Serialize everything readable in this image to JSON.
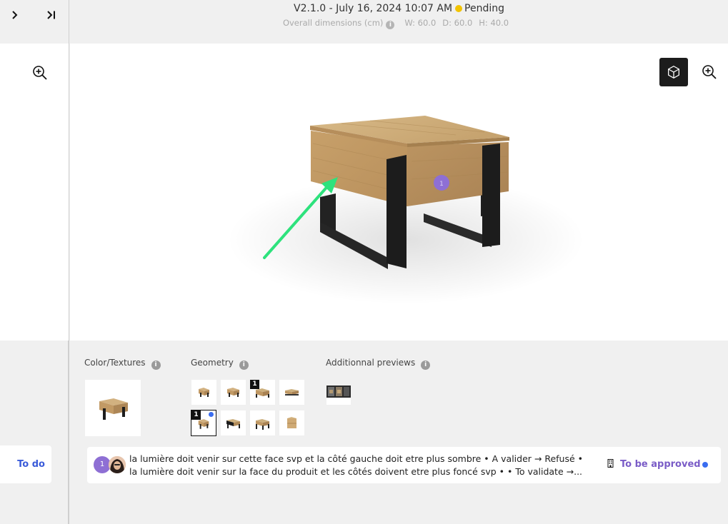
{
  "header": {
    "version": "V2.1.0 - July 16, 2024 10:07 AM",
    "status": "Pending",
    "status_color": "#f2c300",
    "dims_label": "Overall dimensions (cm)",
    "width": "W: 60.0",
    "depth": "D: 60.0",
    "height": "H: 40.0"
  },
  "sidebar": {
    "expand_icon": "chevron-right-icon",
    "collapse_icon": "skip-to-end-icon",
    "todo_label": "To do"
  },
  "viewer": {
    "marker_number": "1",
    "arrow_color": "#2ee27d",
    "marker_color": "#8e6fd4"
  },
  "panel": {
    "color_textures_label": "Color/Textures",
    "geometry_label": "Geometry",
    "additional_label": "Additionnal previews",
    "info_glyph": "i",
    "geometry_badges": [
      "1",
      "1"
    ]
  },
  "comment": {
    "number": "1",
    "line1": "la lumière doit venir sur cette face svp et la côté gauche doit etre plus sombre • A valider → Refusé •",
    "line2": "la lumière doit venir sur la face du produit et les côtés doivent etre plus foncé svp • • To validate →...",
    "status": "To be approved",
    "status_color": "#7a5cc7",
    "dot_color": "#3a6df0"
  }
}
